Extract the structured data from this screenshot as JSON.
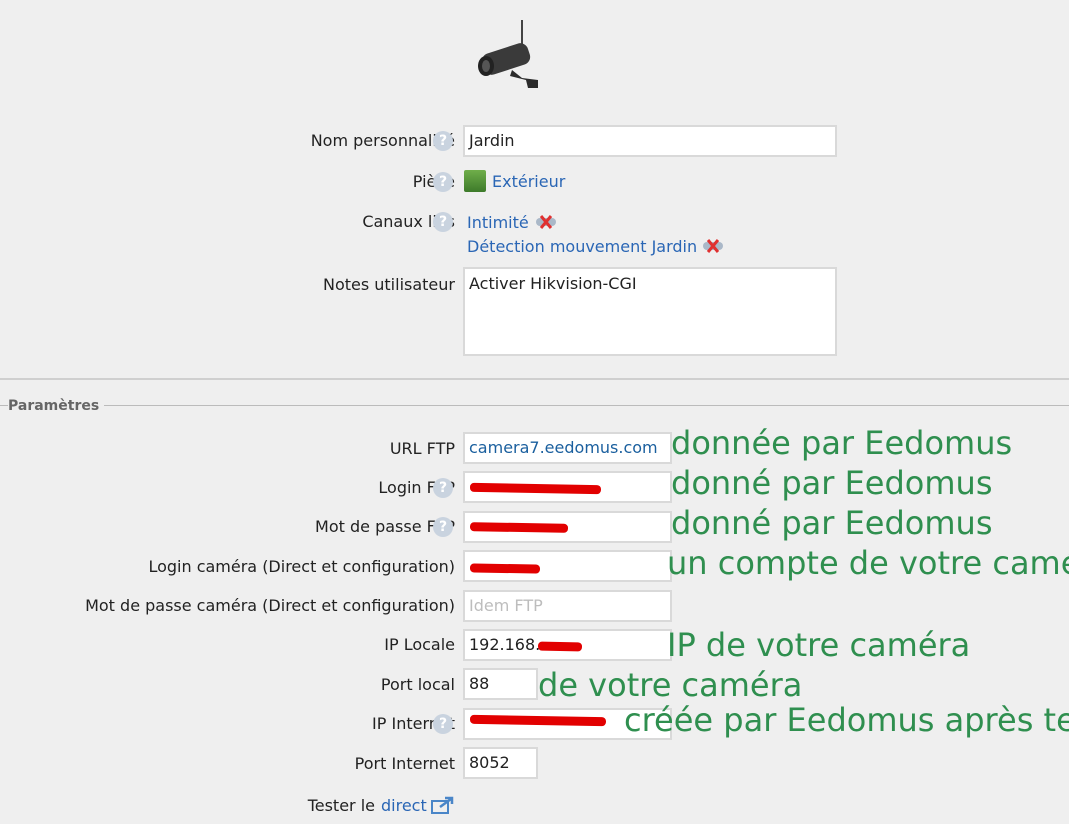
{
  "fields": {
    "name_label": "Nom personnalisé",
    "name_value": "Jardin",
    "room_label": "Pièce",
    "room_value": "Extérieur",
    "channels_label": "Canaux liés",
    "channel_1": "Intimité",
    "channel_2": "Détection mouvement Jardin",
    "notes_label": "Notes utilisateur",
    "notes_value": "Activer Hikvision-CGI"
  },
  "section_title": "Paramètres",
  "params": {
    "url_ftp_label": "URL FTP",
    "url_ftp_value": "camera7.eedomus.com",
    "login_ftp_label": "Login FTP",
    "pwd_ftp_label": "Mot de passe FTP",
    "login_cam_label": "Login caméra (Direct et configuration)",
    "pwd_cam_label": "Mot de passe caméra (Direct et configuration)",
    "pwd_cam_placeholder": "Idem FTP",
    "ip_local_label": "IP Locale",
    "ip_local_value": "192.168.",
    "port_local_label": "Port local",
    "port_local_value": "88",
    "ip_internet_label": "IP Internet",
    "port_internet_label": "Port Internet",
    "port_internet_value": "8052",
    "test_label": "Tester le",
    "test_link": "direct"
  },
  "notes": {
    "url": "donnée par Eedomus",
    "login": "donné par Eedomus",
    "pwd": "donné par Eedomus",
    "cam_login": "un compte de votre caméra",
    "ip_local": "IP de votre caméra",
    "port_local": "de votre caméra",
    "ip_internet": "créée par Eedomus après tests"
  },
  "colors": {
    "link": "#2a66b5",
    "note": "#2f8f4f",
    "redaction": "#e20000"
  },
  "icons": [
    "camera-icon",
    "help-icon",
    "room-thumbnail-icon",
    "remove-link-icon",
    "external-link-icon"
  ]
}
